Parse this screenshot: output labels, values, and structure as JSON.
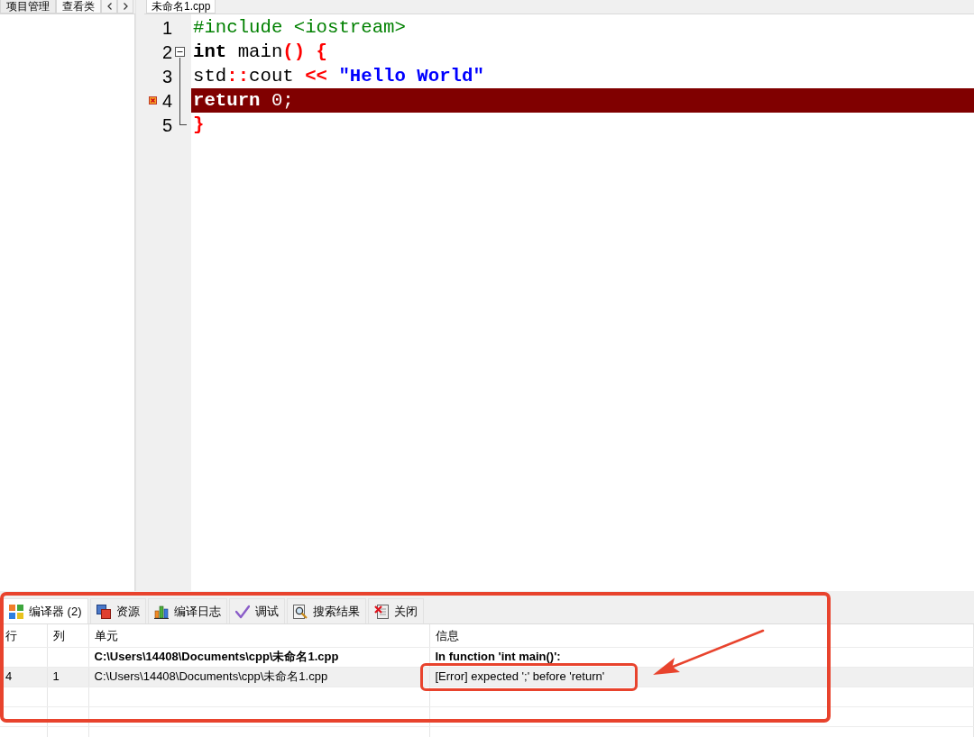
{
  "left_panel": {
    "tabs": [
      {
        "label": "项目管理",
        "selected": false
      },
      {
        "label": "查看类",
        "selected": true
      }
    ]
  },
  "editor": {
    "tabs": [
      {
        "label": "未命名1.cpp",
        "selected": true
      }
    ],
    "lines": [
      {
        "number": "1",
        "error": false,
        "tokens": [
          {
            "text": "#include <iostream>",
            "kind": "preprocessor"
          }
        ]
      },
      {
        "number": "2",
        "error": false,
        "expanded": true,
        "tokens": [
          {
            "text": "int",
            "kind": "keyword"
          },
          {
            "text": " main",
            "kind": "plain"
          },
          {
            "text": "()",
            "kind": "symbol"
          },
          {
            "text": " {",
            "kind": "symbol"
          }
        ],
        "children": [
          {
            "number": "3",
            "error": false,
            "tokens": [
              {
                "text": "std",
                "kind": "plain"
              },
              {
                "text": "::",
                "kind": "symbol"
              },
              {
                "text": "cout",
                "kind": "plain"
              },
              {
                "text": " <<",
                "kind": "symbol"
              },
              {
                "text": " \"Hello World\"",
                "kind": "string"
              }
            ]
          },
          {
            "number": "4",
            "error": true,
            "tokens": [
              {
                "text": "return",
                "kind": "keyword"
              },
              {
                "text": " 0;",
                "kind": "plain"
              }
            ]
          },
          {
            "number": "5",
            "error": false,
            "tokens": [
              {
                "text": "}",
                "kind": "symbol"
              }
            ]
          }
        ]
      }
    ]
  },
  "bottom_panel": {
    "tabs": [
      {
        "label": "编译器 (2)",
        "selected": true
      },
      {
        "label": "资源",
        "selected": false
      },
      {
        "label": "编译日志",
        "selected": false
      },
      {
        "label": "调试",
        "selected": false
      },
      {
        "label": "搜索结果",
        "selected": false
      },
      {
        "label": "关闭",
        "selected": false
      }
    ],
    "table": {
      "columns": [
        "行",
        "列",
        "单元",
        "信息"
      ],
      "rows": [
        {
          "kind": "context",
          "selected": false,
          "unit": "C:\\Users\\14408\\Documents\\cpp\\未命名1.cpp",
          "message": "In function 'int main()':"
        },
        {
          "kind": "error",
          "selected": true,
          "line": "4",
          "column": "1",
          "unit": "C:\\Users\\14408\\Documents\\cpp\\未命名1.cpp",
          "message": "[Error] expected ';' before 'return'"
        }
      ]
    }
  },
  "annotations": [
    {
      "kind": "frame"
    },
    {
      "kind": "ring"
    },
    {
      "kind": "arrow"
    }
  ]
}
